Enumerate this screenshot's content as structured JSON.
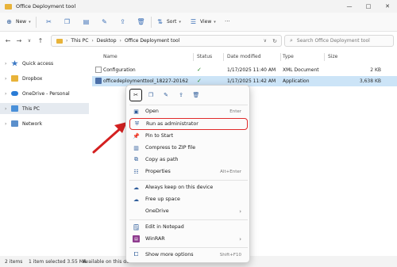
{
  "window": {
    "title": "Office Deployment tool",
    "controls": [
      "—",
      "□",
      "✕"
    ]
  },
  "toolbar": {
    "new_label": "New",
    "sort_label": "Sort",
    "view_label": "View",
    "more": "···"
  },
  "address": {
    "crumbs": [
      "This PC",
      "Desktop",
      "Office Deployment tool"
    ],
    "search_placeholder": "Search Office Deployment tool"
  },
  "sidebar": {
    "items": [
      {
        "label": "Quick access"
      },
      {
        "label": "Dropbox"
      },
      {
        "label": "OneDrive - Personal"
      },
      {
        "label": "This PC"
      },
      {
        "label": "Network"
      }
    ]
  },
  "columns": [
    "Name",
    "Status",
    "Date modified",
    "Type",
    "Size"
  ],
  "files": [
    {
      "name": "Configuration",
      "status": "✓",
      "date": "1/17/2025 11:40 AM",
      "type": "XML Document",
      "size": "2 KB"
    },
    {
      "name": "officedeploymenttool_18227-20162",
      "status": "✓",
      "date": "1/17/2025 11:42 AM",
      "type": "Application",
      "size": "3,638 KB"
    }
  ],
  "statusbar": {
    "count": "2 items",
    "selected": "1 item selected  3.55 MB",
    "availability": "Available on this device"
  },
  "context_menu": {
    "items": [
      {
        "label": "Open",
        "shortcut": "Enter"
      },
      {
        "label": "Run as administrator",
        "shortcut": ""
      },
      {
        "label": "Pin to Start",
        "shortcut": ""
      },
      {
        "label": "Compress to ZIP file",
        "shortcut": ""
      },
      {
        "label": "Copy as path",
        "shortcut": ""
      },
      {
        "label": "Properties",
        "shortcut": "Alt+Enter"
      },
      {
        "label": "Always keep on this device",
        "shortcut": ""
      },
      {
        "label": "Free up space",
        "shortcut": ""
      },
      {
        "label": "OneDrive",
        "shortcut": ""
      },
      {
        "label": "Edit in Notepad",
        "shortcut": ""
      },
      {
        "label": "WinRAR",
        "shortcut": ""
      },
      {
        "label": "Show more options",
        "shortcut": "Shift+F10"
      }
    ]
  },
  "colors": {
    "highlight_border": "#e02a2a",
    "arrow": "#d42020",
    "selection": "#cce4f7",
    "folder": "#e8b339"
  }
}
